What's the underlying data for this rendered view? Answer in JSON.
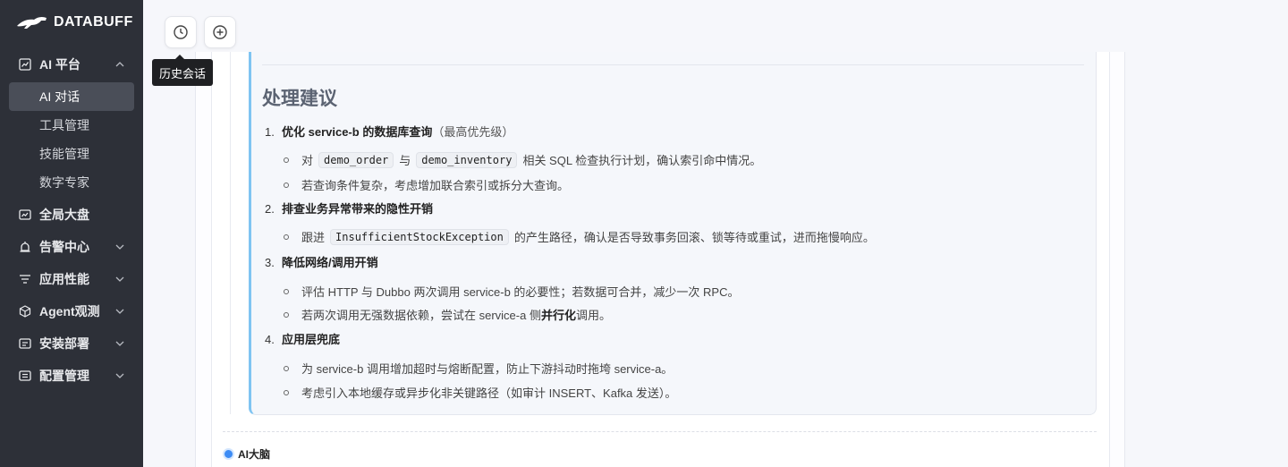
{
  "brand": {
    "name": "DATABUFF"
  },
  "sidebar": {
    "ai_platform": {
      "label": "AI 平台",
      "children": [
        "AI 对话",
        "工具管理",
        "技能管理",
        "数字专家"
      ],
      "active": "AI 对话"
    },
    "items": [
      {
        "label": "全局大盘",
        "icon": "dashboard-icon",
        "expandable": false
      },
      {
        "label": "告警中心",
        "icon": "alarm-icon",
        "expandable": true
      },
      {
        "label": "应用性能",
        "icon": "performance-icon",
        "expandable": true
      },
      {
        "label": "Agent观测",
        "icon": "cube-icon",
        "expandable": true
      },
      {
        "label": "安装部署",
        "icon": "install-icon",
        "expandable": true
      },
      {
        "label": "配置管理",
        "icon": "config-icon",
        "expandable": true
      }
    ]
  },
  "toolbar": {
    "history_tooltip": "历史会话",
    "history_icon": "clock-icon",
    "new_icon": "plus-circle-icon"
  },
  "content": {
    "heading": "处理建议",
    "sections": [
      {
        "num": "1.",
        "title": "优化 service-b 的数据库查询",
        "note": "（最高优先级）",
        "bullets": [
          {
            "pre": "对",
            "code1": "demo_order",
            "mid": "与",
            "code2": "demo_inventory",
            "post": "相关 SQL 检查执行计划，确认索引命中情况。"
          },
          {
            "text": "若查询条件复杂，考虑增加联合索引或拆分大查询。"
          }
        ]
      },
      {
        "num": "2.",
        "title": "排查业务异常带来的隐性开销",
        "bullets": [
          {
            "pre": "跟进",
            "code1": "InsufficientStockException",
            "post": "的产生路径，确认是否导致事务回滚、锁等待或重试，进而拖慢响应。"
          }
        ]
      },
      {
        "num": "3.",
        "title": "降低网络/调用开销",
        "bullets": [
          {
            "text": "评估 HTTP 与 Dubbo 两次调用 service-b 的必要性；若数据可合并，减少一次 RPC。"
          },
          {
            "pre": "若两次调用无强数据依赖，尝试在 service-a 侧",
            "bold": "并行化",
            "post": "调用。"
          }
        ]
      },
      {
        "num": "4.",
        "title": "应用层兜底",
        "bullets": [
          {
            "text": "为 service-b 调用增加超时与熔断配置，防止下游抖动时拖垮 service-a。"
          },
          {
            "text": "考虑引入本地缓存或异步化非关键路径（如审计 INSERT、Kafka 发送）。"
          }
        ]
      }
    ],
    "next_message_label": "AI大脑"
  },
  "colors": {
    "sidebar_bg": "#2d3038",
    "accent_blue": "#3d8cf5",
    "quote_border": "#7fc4f2"
  }
}
